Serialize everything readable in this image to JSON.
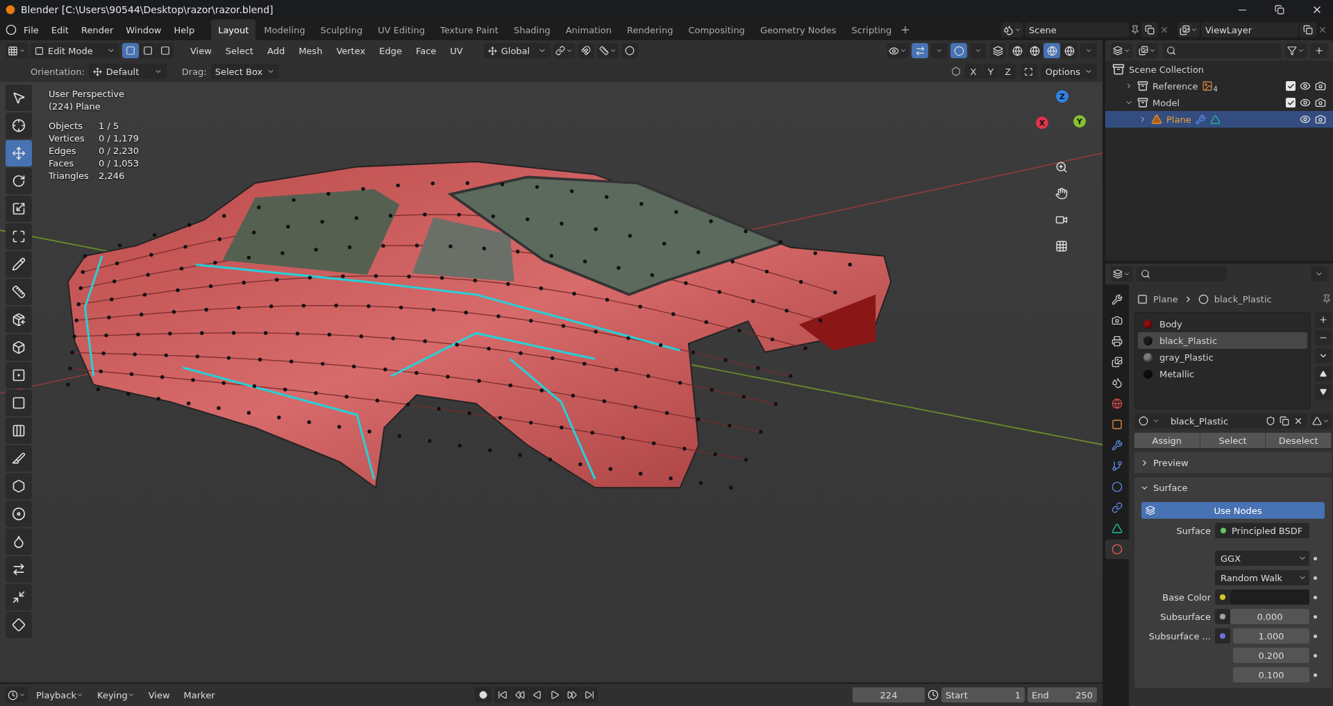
{
  "window": {
    "title": "Blender [C:\\Users\\90544\\Desktop\\razor\\razor.blend]"
  },
  "menu": [
    "File",
    "Edit",
    "Render",
    "Window",
    "Help"
  ],
  "workspaces": [
    {
      "label": "Layout",
      "selected": true
    },
    {
      "label": "Modeling",
      "selected": false
    },
    {
      "label": "Sculpting",
      "selected": false
    },
    {
      "label": "UV Editing",
      "selected": false
    },
    {
      "label": "Texture Paint",
      "selected": false
    },
    {
      "label": "Shading",
      "selected": false
    },
    {
      "label": "Animation",
      "selected": false
    },
    {
      "label": "Rendering",
      "selected": false
    },
    {
      "label": "Compositing",
      "selected": false
    },
    {
      "label": "Geometry Nodes",
      "selected": false
    },
    {
      "label": "Scripting",
      "selected": false
    }
  ],
  "scene": "Scene",
  "view_layer": "ViewLayer",
  "viewport_header": {
    "mode": "Edit Mode",
    "select_modes": [
      {
        "selected": true
      },
      {
        "selected": false
      },
      {
        "selected": false
      }
    ],
    "menus": [
      "View",
      "Select",
      "Add",
      "Mesh",
      "Vertex",
      "Edge",
      "Face",
      "UV"
    ],
    "orientation": "Global",
    "shading_modes": [
      {
        "selected": false
      },
      {
        "selected": false
      },
      {
        "selected": true
      },
      {
        "selected": false
      }
    ]
  },
  "tool_settings": {
    "orientation_label": "Orientation:",
    "orientation": "Default",
    "drag_label": "Drag:",
    "drag": "Select Box",
    "axes": [
      "X",
      "Y",
      "Z"
    ],
    "options": "Options"
  },
  "toolbar": [
    {
      "selected": false
    },
    {
      "selected": false
    },
    {
      "selected": true
    },
    {
      "selected": false
    },
    {
      "selected": false
    },
    {
      "selected": false
    },
    {
      "selected": false
    },
    {
      "selected": false
    },
    {
      "selected": false
    },
    {
      "selected": false
    },
    {
      "selected": false
    },
    {
      "selected": false
    },
    {
      "selected": false
    },
    {
      "selected": false
    },
    {
      "selected": false
    },
    {
      "selected": false
    },
    {
      "selected": false
    },
    {
      "selected": false
    },
    {
      "selected": false
    },
    {
      "selected": false
    }
  ],
  "overlay": {
    "view": "User Perspective",
    "object": "(224) Plane",
    "stats": [
      {
        "label": "Objects",
        "value": "1 / 5"
      },
      {
        "label": "Vertices",
        "value": "0 / 1,179"
      },
      {
        "label": "Edges",
        "value": "0 / 2,230"
      },
      {
        "label": "Faces",
        "value": "0 / 1,053"
      },
      {
        "label": "Triangles",
        "value": "2,246"
      }
    ]
  },
  "gizmo": [
    {
      "label": "X",
      "color": "#e0344a"
    },
    {
      "label": "Y",
      "color": "#86c02f"
    },
    {
      "label": "Z",
      "color": "#2f84e3"
    }
  ],
  "outliner": {
    "root": "Scene Collection",
    "items": [
      {
        "name": "Reference",
        "expanded": false,
        "selected": false,
        "checked": true,
        "badge": "4"
      },
      {
        "name": "Model",
        "expanded": true,
        "selected": false,
        "checked": true,
        "children": [
          {
            "name": "Plane",
            "expanded": false,
            "selected": true
          }
        ]
      }
    ]
  },
  "properties": {
    "tabs": [
      {
        "selected": false
      },
      {
        "selected": false
      },
      {
        "selected": false
      },
      {
        "selected": false
      },
      {
        "selected": false
      },
      {
        "selected": false
      },
      {
        "selected": false
      },
      {
        "selected": false
      },
      {
        "selected": false
      },
      {
        "selected": false
      },
      {
        "selected": false
      },
      {
        "selected": false
      },
      {
        "selected": true
      }
    ],
    "breadcrumb": [
      "Plane",
      "black_Plastic"
    ],
    "slots": [
      {
        "name": "Body",
        "selected": false,
        "color": "#8a1010"
      },
      {
        "name": "black_Plastic",
        "selected": true,
        "color": "#1c1c1c"
      },
      {
        "name": "gray_Plastic",
        "selected": false,
        "color": "#7a7a7a"
      },
      {
        "name": "Metallic",
        "selected": false,
        "color": "#0e0e0e"
      }
    ],
    "material": "black_Plastic",
    "actions": [
      "Assign",
      "Select",
      "Deselect"
    ],
    "panels": [
      {
        "title": "Preview",
        "expanded": false
      },
      {
        "title": "Surface",
        "expanded": true
      }
    ],
    "use_nodes": "Use Nodes",
    "surface": {
      "label": "Surface",
      "value": "Principled BSDF",
      "color": "#63c763"
    },
    "dropdowns": [
      "GGX",
      "Random Walk"
    ],
    "inputs": [
      {
        "kind": "color",
        "label": "Base Color",
        "color": "#d6c62a"
      },
      {
        "kind": "number",
        "label": "Subsurface",
        "color": "#a3a3a3",
        "values": [
          "0.000"
        ]
      },
      {
        "kind": "vector",
        "label": "Subsurface ...",
        "color": "#6f6fd9",
        "values": [
          "1.000",
          "0.200",
          "0.100"
        ]
      }
    ]
  },
  "timeline": {
    "menus": [
      "Playback",
      "Keying",
      "View",
      "Marker"
    ],
    "frame": "224",
    "start_label": "Start",
    "start": "1",
    "end_label": "End",
    "end": "250"
  }
}
